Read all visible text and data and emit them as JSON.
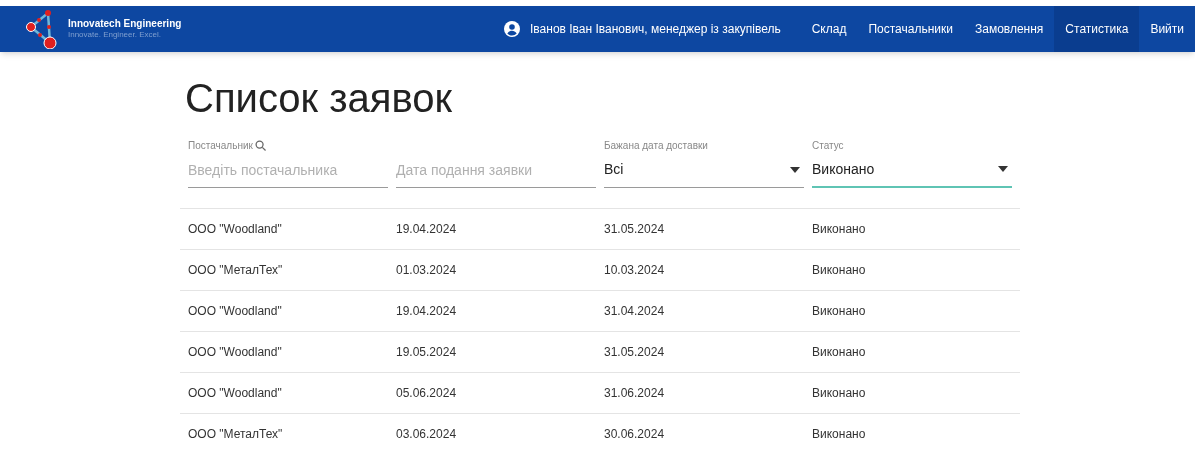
{
  "brand": {
    "name": "Innovatech Engineering",
    "tagline": "Innovate. Engineer. Excel."
  },
  "user": "Іванов Іван Іванович, менеджер із закупівель",
  "nav": [
    {
      "label": "Склад",
      "selected": false
    },
    {
      "label": "Постачальники",
      "selected": false
    },
    {
      "label": "Замовлення",
      "selected": false
    },
    {
      "label": "Статистика",
      "selected": true
    },
    {
      "label": "Вийти",
      "selected": false
    }
  ],
  "title": "Список заявок",
  "filters": [
    {
      "kind": "search",
      "label": "Постачальник",
      "placeholder": "Введіть постачальника",
      "focused": false
    },
    {
      "kind": "text",
      "placeholder": "Дата подання заявки",
      "focused": false
    },
    {
      "kind": "select",
      "label": "Бажана дата доставки",
      "value": "Всі",
      "focused": false
    },
    {
      "kind": "select",
      "label": "Статус",
      "value": "Виконано",
      "focused": true
    }
  ],
  "rows": [
    [
      "ООО \"Woodland\"",
      "19.04.2024",
      "31.05.2024",
      "Виконано"
    ],
    [
      "ООО \"МеталТех\"",
      "01.03.2024",
      "10.03.2024",
      "Виконано"
    ],
    [
      "ООО \"Woodland\"",
      "19.04.2024",
      "31.04.2024",
      "Виконано"
    ],
    [
      "ООО \"Woodland\"",
      "19.05.2024",
      "31.05.2024",
      "Виконано"
    ],
    [
      "ООО \"Woodland\"",
      "05.06.2024",
      "31.06.2024",
      "Виконано"
    ],
    [
      "ООО \"МеталТех\"",
      "03.06.2024",
      "30.06.2024",
      "Виконано"
    ]
  ]
}
